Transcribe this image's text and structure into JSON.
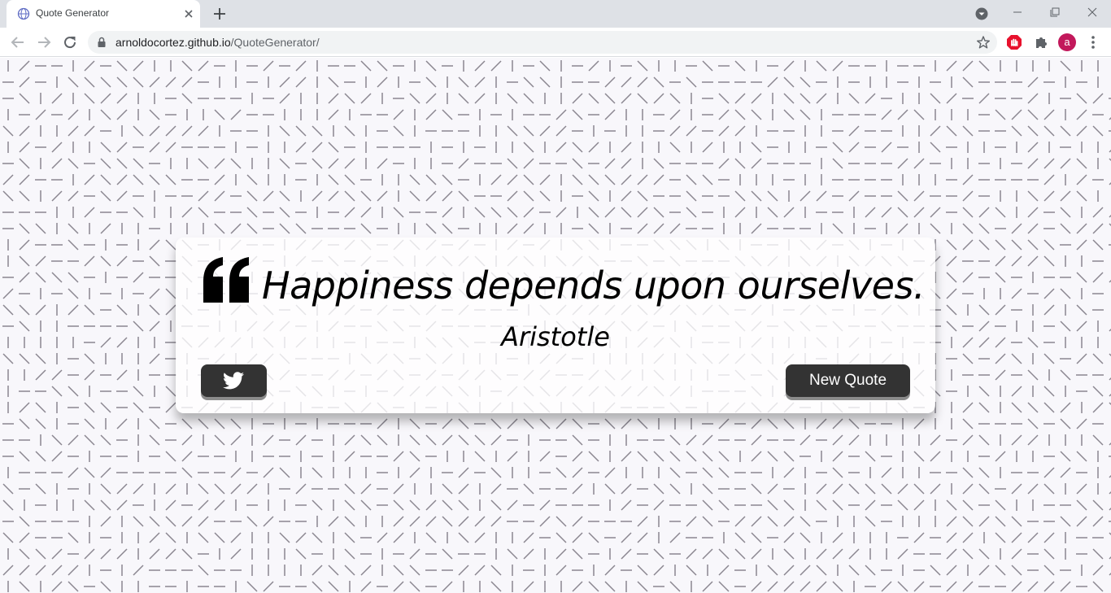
{
  "browser": {
    "tab_title": "Quote Generator",
    "url_host": "arnoldocortez.github.io",
    "url_path": "/QuoteGenerator/",
    "profile_initial": "a",
    "icons": [
      "globe-icon",
      "close-icon",
      "plus-icon",
      "tab-search-icon",
      "minimize-icon",
      "maximize-icon",
      "window-close-icon",
      "back-icon",
      "forward-icon",
      "reload-icon",
      "lock-icon",
      "star-icon",
      "adblock-icon",
      "puzzle-icon",
      "more-icon"
    ]
  },
  "quote": {
    "text": "Happiness depends upon ourselves.",
    "author": "Aristotle"
  },
  "buttons": {
    "twitter_icon": "twitter-icon",
    "new_quote_label": "New Quote"
  },
  "colors": {
    "button_bg": "#333333",
    "avatar": "#c2185b",
    "adblock": "#e8112d",
    "pattern_stroke": "#8a8690",
    "page_bg": "#f8f7fb"
  }
}
